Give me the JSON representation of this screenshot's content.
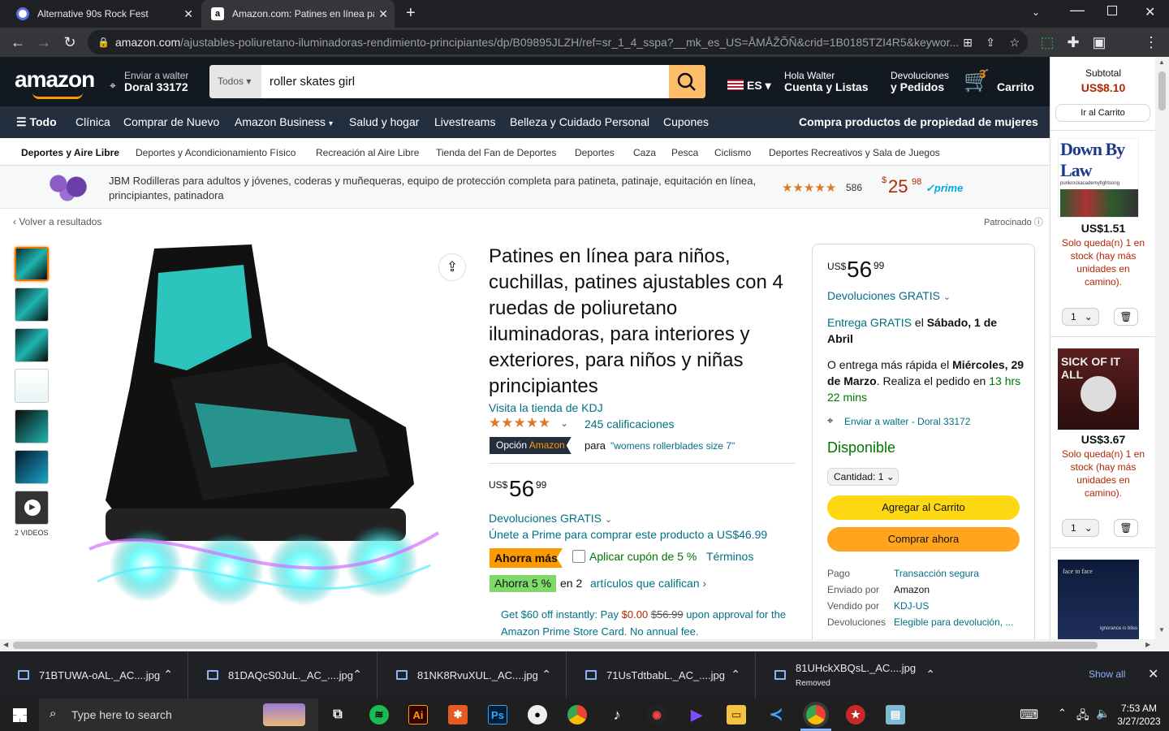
{
  "browser": {
    "tabs": [
      {
        "title": "Alternative 90s Rock Fest"
      },
      {
        "title": "Amazon.com: Patines en línea pa"
      }
    ],
    "new_tab_label": "+",
    "url_domain": "amazon.com",
    "url_path": "/ajustables-poliuretano-iluminadoras-rendimiento-principiantes/dp/B09895JLZH/ref=sr_1_4_sspa?__mk_es_US=ÅMÅŽÕÑ&crid=1B0185TZI4R5&keywor..."
  },
  "header": {
    "logo": "amazon",
    "deliver_line1": "Enviar a walter",
    "deliver_line2": "Doral 33172",
    "search_category": "Todos",
    "search_value": "roller skates girl",
    "language": "ES",
    "account_line1": "Hola Walter",
    "account_line2": "Cuenta y Listas",
    "returns_line1": "Devoluciones",
    "returns_line2": "y Pedidos",
    "cart_count": "3",
    "cart_label": "Carrito"
  },
  "nav": {
    "all_label": "Todo",
    "items": [
      "Clínica",
      "Comprar de Nuevo",
      "Amazon Business",
      "Salud y hogar",
      "Livestreams",
      "Belleza y Cuidado Personal",
      "Cupones"
    ],
    "promo": "Compra productos de propiedad de mujeres"
  },
  "subnav": {
    "items": [
      "Deportes y Aire Libre",
      "Deportes y Acondicionamiento Físico",
      "Recreación al Aire Libre",
      "Tienda del Fan de Deportes",
      "Deportes",
      "Caza",
      "Pesca",
      "Ciclismo",
      "Deportes Recreativos y Sala de Juegos"
    ]
  },
  "ad": {
    "text": "JBM Rodilleras para adultos y jóvenes, coderas y muñequeras, equipo de protección completa para patineta, patinaje, equitación en línea, principiantes, patinadora",
    "stars": "★★★★★",
    "rating_count": "586",
    "price_symbol": "$",
    "price_whole": "25",
    "price_cents": "98",
    "prime": "✓prime"
  },
  "page": {
    "back_link": "Volver a resultados",
    "sponsored": "Patrocinado",
    "videos_label": "2 VIDEOS"
  },
  "product": {
    "title": "Patines en línea para niños, cuchillas, patines ajustables con 4 ruedas de poliuretano iluminadoras, para interiores y exteriores, para niños y niñas principiantes",
    "store_link": "Visita la tienda de KDJ",
    "stars": "★★★★★",
    "ratings": "245 calificaciones",
    "choice_badge_1": "Opción",
    "choice_badge_2": "Amazon",
    "choice_for": "para",
    "choice_query": "\"womens rollerblades size 7\"",
    "price_currency": "US$",
    "price_whole": "56",
    "price_cents": "99",
    "returns": "Devoluciones GRATIS",
    "prime_offer": "Únete a Prime para comprar este producto a US$46.99",
    "savings_badge": "Ahorra más",
    "coupon_label": "Aplicar cupón de 5 %",
    "terms": "Términos",
    "save5_badge": "Ahorra 5 %",
    "save5_in": "en 2",
    "save5_link": "artículos que califican",
    "card_offer_1": "Get $60 off instantly: Pay",
    "card_offer_price": "$0.00",
    "card_offer_old": "$56.99",
    "card_offer_2": "upon approval for",
    "card_offer_3": "the Amazon Prime Store Card. No annual fee."
  },
  "buybox": {
    "price_currency": "US$",
    "price_whole": "56",
    "price_cents": "99",
    "returns": "Devoluciones GRATIS",
    "delivery_free": "Entrega GRATIS",
    "delivery_el": "el",
    "delivery_date": "Sábado, 1 de Abril",
    "fast_prefix": "O entrega más rápida el",
    "fast_date": "Miércoles, 29 de Marzo",
    "fast_mid": ". Realiza el pedido en",
    "fast_timer": "13 hrs 22 mins",
    "deliver_to": "Enviar a walter - Doral 33172",
    "availability": "Disponible",
    "quantity": "Cantidad: 1",
    "add_to_cart": "Agregar al Carrito",
    "buy_now": "Comprar ahora",
    "details": [
      {
        "k": "Pago",
        "v": "Transacción segura"
      },
      {
        "k": "Enviado por",
        "v": "Amazon"
      },
      {
        "k": "Vendido por",
        "v": "KDJ-US"
      },
      {
        "k": "Devoluciones",
        "v": "Elegible para devolución, ..."
      }
    ]
  },
  "side": {
    "subtotal_label": "Subtotal",
    "subtotal": "US$8.10",
    "goto_cart": "Ir al Carrito",
    "items": [
      {
        "cover_title": "Down By Law",
        "cover_sub": "punkrockacademyfightsong",
        "price": "US$1.51",
        "stock": "Solo queda(n) 1 en stock (hay más unidades en camino).",
        "qty": "1"
      },
      {
        "cover_title": "SICK OF IT ALL",
        "price": "US$3.67",
        "stock": "Solo queda(n) 1 en stock (hay más unidades en camino).",
        "qty": "1"
      },
      {
        "cover_title": "face to face",
        "cover_sub": "ignorance is bliss"
      }
    ]
  },
  "downloads": {
    "items": [
      {
        "name": "71BTUWA-oAL._AC....jpg"
      },
      {
        "name": "81DAQcS0JuL._AC_....jpg"
      },
      {
        "name": "81NK8RvuXUL._AC....jpg"
      },
      {
        "name": "71UsTdtbabL._AC_....jpg"
      },
      {
        "name": "81UHckXBQsL._AC....jpg",
        "status": "Removed"
      }
    ],
    "show_all": "Show all"
  },
  "taskbar": {
    "search_placeholder": "Type here to search",
    "time": "7:53 AM",
    "date": "3/27/2023",
    "apps": [
      "Ai",
      "Ps"
    ]
  },
  "colors": {
    "amazon_dark": "#131921",
    "amazon_nav": "#232f3e",
    "amazon_orange": "#febd69",
    "link_teal": "#007185",
    "price_red": "#b12704",
    "available_green": "#007600",
    "cart_yellow": "#ffd814",
    "buy_orange": "#ffa41c"
  }
}
